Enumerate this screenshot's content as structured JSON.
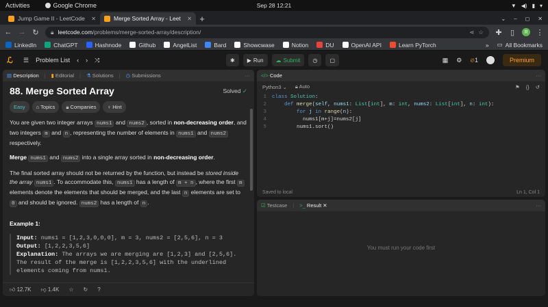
{
  "os": {
    "activities": "Activities",
    "app": "Google Chrome",
    "clock": "Sep 28  12:21"
  },
  "tabs": [
    {
      "label": "Jump Game II - LeetCode"
    },
    {
      "label": "Merge Sorted Array - Leet"
    }
  ],
  "url": {
    "host": "leetcode.com",
    "path": "/problems/merge-sorted-array/description/"
  },
  "avatar_letter": "R",
  "bookmarks": [
    "LinkedIn",
    "ChatGPT",
    "Hashnode",
    "Github",
    "AngelList",
    "Bard",
    "Showcwase",
    "Notion",
    "DU",
    "OpenAI API",
    "Learn PyTorch"
  ],
  "all_bookmarks": "All Bookmarks",
  "lc": {
    "problem_list": "Problem List",
    "run": "Run",
    "submit": "Submit",
    "streak": "1",
    "premium": "Premium"
  },
  "desc_tabs": [
    "Description",
    "Editorial",
    "Solutions",
    "Submissions"
  ],
  "problem": {
    "title": "88. Merge Sorted Array",
    "solved": "Solved",
    "pills": [
      "Easy",
      "Topics",
      "Companies",
      "Hint"
    ],
    "p1": [
      "You are given two integer arrays ",
      "nums1",
      " and ",
      "nums2",
      ", sorted in ",
      "non-decreasing order",
      ", and two integers ",
      "m",
      " and ",
      "n",
      ", representing the number of elements in ",
      "nums1",
      " and ",
      "nums2",
      " respectively."
    ],
    "p2": [
      "Merge ",
      "nums1",
      " and ",
      "nums2",
      " into a single array sorted in ",
      "non-decreasing order",
      "."
    ],
    "p3": [
      "The final sorted array should not be returned by the function, but instead be ",
      "stored inside the array ",
      "nums1",
      ". To accommodate this, ",
      "nums1",
      " has a length of ",
      "m + n",
      ", where the first ",
      "m",
      " elements denote the elements that should be merged, and the last ",
      "n",
      " elements are set to ",
      "0",
      " and should be ignored. ",
      "nums2",
      " has a length of ",
      "n",
      "."
    ],
    "example_title": "Example 1:",
    "ex_input_label": "Input:",
    "ex_input": " nums1 = [1,2,3,0,0,0], m = 3, nums2 = [2,5,6], n = 3",
    "ex_output_label": "Output:",
    "ex_output": " [1,2,2,3,5,6]",
    "ex_expl_label": "Explanation:",
    "ex_expl": " The arrays we are merging are [1,2,3] and [2,5,6]. The result of the merge is [1,2,2,3,5,6] with the underlined elements coming from nums1.",
    "likes": "12.7K",
    "dislikes": "1.4K"
  },
  "code": {
    "tab": "Code",
    "lang": "Python3",
    "auto": "Auto",
    "saved": "Saved to local",
    "pos": "Ln 1, Col 1"
  },
  "result": {
    "testcase": "Testcase",
    "result": "Result",
    "msg": "You must run your code first"
  }
}
